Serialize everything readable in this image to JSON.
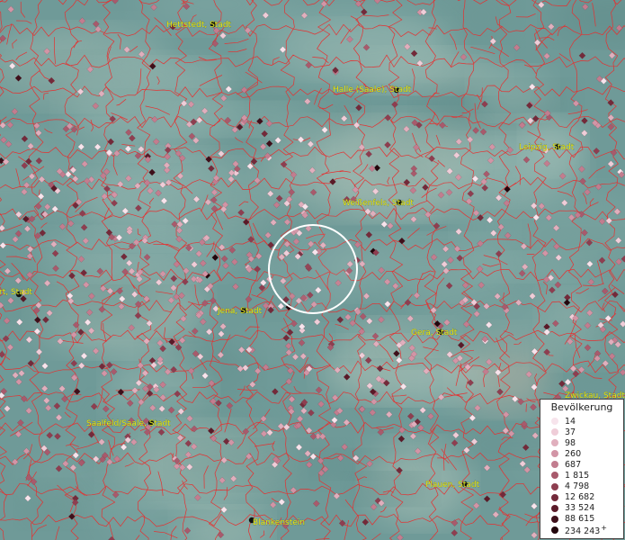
{
  "map": {
    "cities": [
      {
        "id": "hettstedt",
        "name": "Hettstedt, Stadt"
      },
      {
        "id": "halle",
        "name": "Halle (Saale), Stadt"
      },
      {
        "id": "leipzig",
        "name": "Leipzig, Stadt"
      },
      {
        "id": "weissenfels",
        "name": "Weißenfels, Stadt"
      },
      {
        "id": "erfurt",
        "name": "rt, Stadt"
      },
      {
        "id": "jena",
        "name": "Jena, Stadt"
      },
      {
        "id": "gera",
        "name": "Gera, Stadt"
      },
      {
        "id": "zwickau",
        "name": "Zwickau, Stadt"
      },
      {
        "id": "saalfeld",
        "name": "Saalfeld/Saale, Stadt"
      },
      {
        "id": "plauen",
        "name": "Plauen, Stadt"
      },
      {
        "id": "blankenstein",
        "name": "Blankenstein"
      }
    ],
    "colors": {
      "background": "#6f9a98",
      "boundary": "#e53030",
      "city_label": "#e8e41a",
      "selection_circle": "#ffffff"
    }
  },
  "legend": {
    "title": "Bevölkerung",
    "open_end_marker": "+",
    "items": [
      {
        "label": "14",
        "color": "#f7e4ec"
      },
      {
        "label": "37",
        "color": "#efcdd8"
      },
      {
        "label": "98",
        "color": "#e0afbd"
      },
      {
        "label": "260",
        "color": "#d295a6"
      },
      {
        "label": "687",
        "color": "#c27d8f"
      },
      {
        "label": "1 815",
        "color": "#a85a6c"
      },
      {
        "label": "4 798",
        "color": "#8e3e50"
      },
      {
        "label": "12 682",
        "color": "#732a3a"
      },
      {
        "label": "33 524",
        "color": "#5a1a28"
      },
      {
        "label": "88 615",
        "color": "#3e0f1a"
      },
      {
        "label": "234 243",
        "color": "#22060c"
      }
    ]
  }
}
